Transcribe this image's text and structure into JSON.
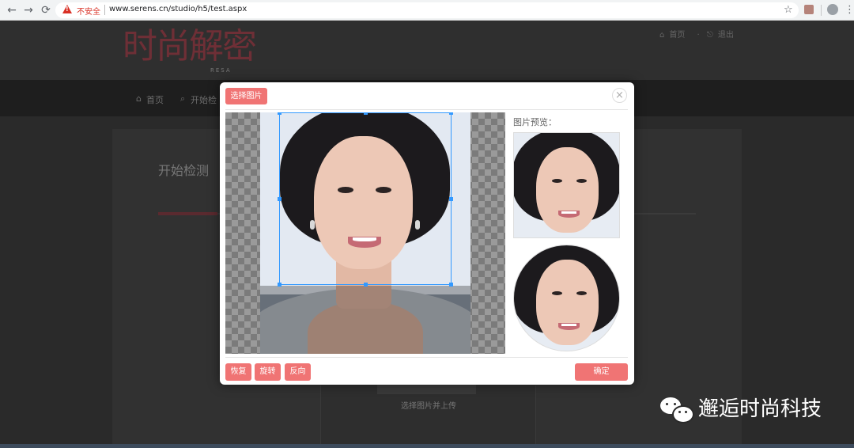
{
  "browser": {
    "back_icon": "←",
    "forward_icon": "→",
    "reload_icon": "⟳",
    "security_label": "不安全",
    "url": "www.serens.cn/studio/h5/test.aspx",
    "star_icon": "☆",
    "menu_icon": "⋮"
  },
  "site": {
    "logo_text": "时尚解密",
    "logo_sub": "RESA",
    "top_links": [
      "首页",
      "退出"
    ],
    "nav": [
      "首页",
      "开始检"
    ],
    "page_title": "开始检测",
    "upload_label": "选择图片并上传"
  },
  "modal": {
    "pick_image_label": "选择图片",
    "close_icon": "×",
    "preview_label": "图片预览：",
    "reset_label": "恢复",
    "rotate_label": "旋转",
    "flip_label": "反向",
    "confirm_label": "确定"
  },
  "watermark": {
    "text": "邂逅时尚科技"
  },
  "colors": {
    "accent": "#f07474",
    "crop_border": "#3399ff",
    "page_dark": "#2b2b2b"
  }
}
